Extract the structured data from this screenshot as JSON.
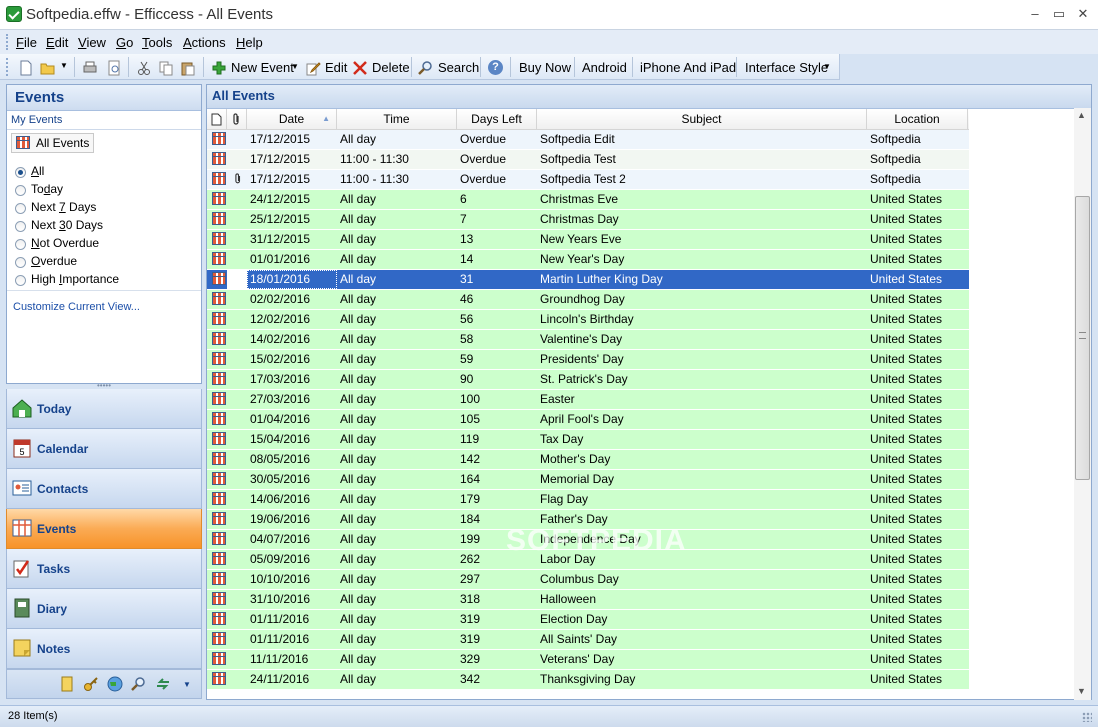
{
  "window": {
    "title": "Softpedia.effw - Efficcess - All Events",
    "min": "‒",
    "max": "▭",
    "close": "✕"
  },
  "menu": [
    {
      "pre": "",
      "u": "F",
      "post": "ile"
    },
    {
      "pre": "",
      "u": "E",
      "post": "dit"
    },
    {
      "pre": "",
      "u": "V",
      "post": "iew"
    },
    {
      "pre": "",
      "u": "G",
      "post": "o"
    },
    {
      "pre": "",
      "u": "T",
      "post": "ools"
    },
    {
      "pre": "",
      "u": "A",
      "post": "ctions"
    },
    {
      "pre": "",
      "u": "H",
      "post": "elp"
    }
  ],
  "toolbar": {
    "new_event": "New Event",
    "edit": "Edit",
    "delete": "Delete",
    "search": "Search",
    "buy_now": "Buy Now",
    "android": "Android",
    "iphone": "iPhone And iPad",
    "interface_style": "Interface Style"
  },
  "sidebar": {
    "title": "Events",
    "my_events": "My Events",
    "all_events": "All Events",
    "filters": [
      {
        "pre": "",
        "u": "A",
        "post": "ll",
        "checked": true
      },
      {
        "pre": "To",
        "u": "d",
        "post": "ay",
        "checked": false
      },
      {
        "pre": "Next ",
        "u": "7",
        "post": " Days",
        "checked": false
      },
      {
        "pre": "Next ",
        "u": "3",
        "post": "0 Days",
        "checked": false
      },
      {
        "pre": "",
        "u": "N",
        "post": "ot Overdue",
        "checked": false
      },
      {
        "pre": "",
        "u": "O",
        "post": "verdue",
        "checked": false
      },
      {
        "pre": "High ",
        "u": "I",
        "post": "mportance",
        "checked": false
      }
    ],
    "customize": "Customize Current View...",
    "grip": "•••••",
    "nav": [
      "Today",
      "Calendar",
      "Contacts",
      "Events",
      "Tasks",
      "Diary",
      "Notes"
    ],
    "active_nav": "Events"
  },
  "main": {
    "title": "All Events",
    "columns": {
      "date": "Date",
      "time": "Time",
      "days_left": "Days Left",
      "subject": "Subject",
      "location": "Location"
    },
    "rows": [
      {
        "date": "17/12/2015",
        "time": "All day",
        "days": "Overdue",
        "subject": "Softpedia Edit",
        "location": "Softpedia",
        "style": "overdue",
        "attach": false
      },
      {
        "date": "17/12/2015",
        "time": "11:00 - 11:30",
        "days": "Overdue",
        "subject": "Softpedia Test",
        "location": "Softpedia",
        "style": "overdue2",
        "attach": false
      },
      {
        "date": "17/12/2015",
        "time": "11:00 - 11:30",
        "days": "Overdue",
        "subject": "Softpedia Test 2",
        "location": "Softpedia",
        "style": "overdue",
        "attach": true
      },
      {
        "date": "24/12/2015",
        "time": "All day",
        "days": "6",
        "subject": "Christmas Eve",
        "location": "United States",
        "style": "green",
        "attach": false
      },
      {
        "date": "25/12/2015",
        "time": "All day",
        "days": "7",
        "subject": "Christmas Day",
        "location": "United States",
        "style": "green",
        "attach": false
      },
      {
        "date": "31/12/2015",
        "time": "All day",
        "days": "13",
        "subject": "New Years Eve",
        "location": "United States",
        "style": "green",
        "attach": false
      },
      {
        "date": "01/01/2016",
        "time": "All day",
        "days": "14",
        "subject": "New Year's Day",
        "location": "United States",
        "style": "green",
        "attach": false
      },
      {
        "date": "18/01/2016",
        "time": "All day",
        "days": "31",
        "subject": "Martin Luther King Day",
        "location": "United States",
        "style": "sel",
        "attach": false
      },
      {
        "date": "02/02/2016",
        "time": "All day",
        "days": "46",
        "subject": "Groundhog Day",
        "location": "United States",
        "style": "green",
        "attach": false
      },
      {
        "date": "12/02/2016",
        "time": "All day",
        "days": "56",
        "subject": "Lincoln's Birthday",
        "location": "United States",
        "style": "green",
        "attach": false
      },
      {
        "date": "14/02/2016",
        "time": "All day",
        "days": "58",
        "subject": "Valentine's Day",
        "location": "United States",
        "style": "green",
        "attach": false
      },
      {
        "date": "15/02/2016",
        "time": "All day",
        "days": "59",
        "subject": "Presidents' Day",
        "location": "United States",
        "style": "green",
        "attach": false
      },
      {
        "date": "17/03/2016",
        "time": "All day",
        "days": "90",
        "subject": "St. Patrick's Day",
        "location": "United States",
        "style": "green",
        "attach": false
      },
      {
        "date": "27/03/2016",
        "time": "All day",
        "days": "100",
        "subject": "Easter",
        "location": "United States",
        "style": "green",
        "attach": false
      },
      {
        "date": "01/04/2016",
        "time": "All day",
        "days": "105",
        "subject": "April Fool's Day",
        "location": "United States",
        "style": "green",
        "attach": false
      },
      {
        "date": "15/04/2016",
        "time": "All day",
        "days": "119",
        "subject": "Tax Day",
        "location": "United States",
        "style": "green",
        "attach": false
      },
      {
        "date": "08/05/2016",
        "time": "All day",
        "days": "142",
        "subject": "Mother's Day",
        "location": "United States",
        "style": "green",
        "attach": false
      },
      {
        "date": "30/05/2016",
        "time": "All day",
        "days": "164",
        "subject": "Memorial Day",
        "location": "United States",
        "style": "green",
        "attach": false
      },
      {
        "date": "14/06/2016",
        "time": "All day",
        "days": "179",
        "subject": "Flag Day",
        "location": "United States",
        "style": "green",
        "attach": false
      },
      {
        "date": "19/06/2016",
        "time": "All day",
        "days": "184",
        "subject": "Father's Day",
        "location": "United States",
        "style": "green",
        "attach": false
      },
      {
        "date": "04/07/2016",
        "time": "All day",
        "days": "199",
        "subject": "Independence Day",
        "location": "United States",
        "style": "green",
        "attach": false
      },
      {
        "date": "05/09/2016",
        "time": "All day",
        "days": "262",
        "subject": "Labor Day",
        "location": "United States",
        "style": "green",
        "attach": false
      },
      {
        "date": "10/10/2016",
        "time": "All day",
        "days": "297",
        "subject": "Columbus Day",
        "location": "United States",
        "style": "green",
        "attach": false
      },
      {
        "date": "31/10/2016",
        "time": "All day",
        "days": "318",
        "subject": "Halloween",
        "location": "United States",
        "style": "green",
        "attach": false
      },
      {
        "date": "01/11/2016",
        "time": "All day",
        "days": "319",
        "subject": "Election Day",
        "location": "United States",
        "style": "green",
        "attach": false
      },
      {
        "date": "01/11/2016",
        "time": "All day",
        "days": "319",
        "subject": "All Saints' Day",
        "location": "United States",
        "style": "green",
        "attach": false
      },
      {
        "date": "11/11/2016",
        "time": "All day",
        "days": "329",
        "subject": "Veterans' Day",
        "location": "United States",
        "style": "green",
        "attach": false
      },
      {
        "date": "24/11/2016",
        "time": "All day",
        "days": "342",
        "subject": "Thanksgiving Day",
        "location": "United States",
        "style": "green",
        "attach": false
      }
    ]
  },
  "status": {
    "items": "28 Item(s)"
  },
  "watermark": "SOFTPEDIA",
  "colors": {
    "green_row": "#ccffcc",
    "selected_row": "#3168c6",
    "active_nav": "#f79328",
    "header_text": "#15428b"
  }
}
